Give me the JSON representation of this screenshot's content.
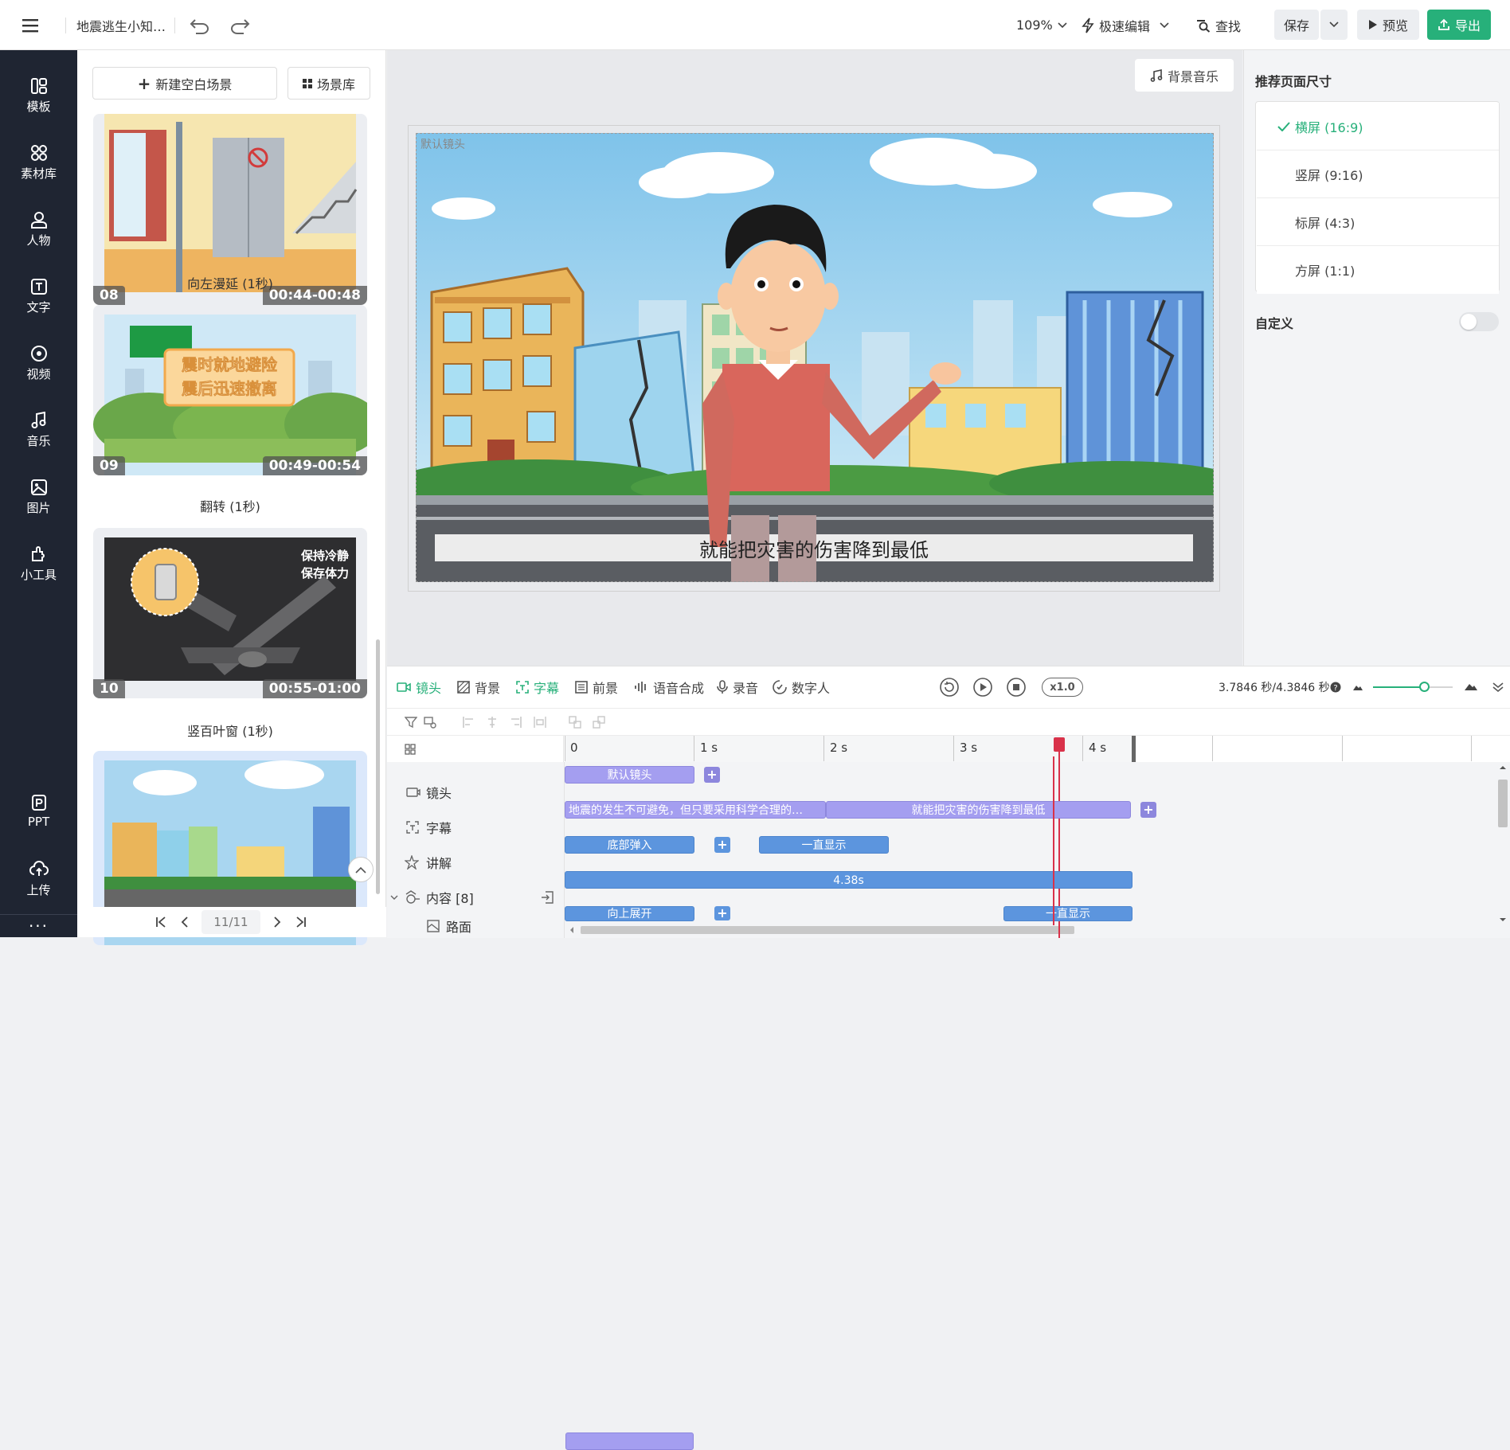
{
  "topbar": {
    "title": "地震逃生小知…",
    "zoom": "109%",
    "mode": "极速编辑",
    "find": "查找",
    "save": "保存",
    "preview": "预览",
    "export": "导出"
  },
  "nav": [
    {
      "label": "模板",
      "icon": "template-icon"
    },
    {
      "label": "素材库",
      "icon": "material-icon"
    },
    {
      "label": "人物",
      "icon": "person-icon"
    },
    {
      "label": "文字",
      "icon": "text-icon"
    },
    {
      "label": "视频",
      "icon": "video-icon"
    },
    {
      "label": "音乐",
      "icon": "music-icon"
    },
    {
      "label": "图片",
      "icon": "image-icon"
    },
    {
      "label": "小工具",
      "icon": "tools-icon"
    }
  ],
  "nav_bottom": [
    {
      "label": "PPT",
      "icon": "ppt-icon"
    },
    {
      "label": "上传",
      "icon": "upload-icon"
    }
  ],
  "scene_panel": {
    "new_scene": "新建空白场景",
    "library": "场景库",
    "scenes": [
      {
        "num": "08",
        "time": "00:44-00:48",
        "label": "向左漫延 (1秒)"
      },
      {
        "num": "09",
        "time": "00:49-00:54",
        "label": "翻转 (1秒)",
        "sign_line1": "震时就地避险",
        "sign_line2": "震后迅速撤离"
      },
      {
        "num": "10",
        "time": "00:55-01:00",
        "label": "竖百叶窗 (1秒)",
        "text_line1": "保持冷静",
        "text_line2": "保存体力"
      }
    ],
    "pager": "11/11"
  },
  "canvas": {
    "bg_music": "背景音乐",
    "default_lens": "默认镜头",
    "subtitle": "就能把灾害的伤害降到最低"
  },
  "right_panel": {
    "title": "推荐页面尺寸",
    "options": [
      {
        "label": "横屏 (16:9)",
        "selected": true
      },
      {
        "label": "竖屏 (9:16)",
        "selected": false
      },
      {
        "label": "标屏 (4:3)",
        "selected": false
      },
      {
        "label": "方屏 (1:1)",
        "selected": false
      }
    ],
    "custom": "自定义"
  },
  "timeline": {
    "tabs": [
      "镜头",
      "背景",
      "字幕",
      "前景",
      "语音合成",
      "录音",
      "数字人"
    ],
    "speed": "x1.0",
    "time_readout": "3.7846 秒/4.3846 秒",
    "ruler": [
      "0",
      "1 s",
      "2 s",
      "3 s",
      "4 s"
    ],
    "tracks": [
      {
        "label": "镜头",
        "icon": "camera-icon"
      },
      {
        "label": "字幕",
        "icon": "subtitle-icon"
      },
      {
        "label": "讲解",
        "icon": "star-icon"
      },
      {
        "label": "内容 [8]",
        "icon": "content-icon"
      },
      {
        "label": "路面",
        "icon": "image-layer-icon"
      }
    ],
    "clips": {
      "lens": "默认镜头",
      "subtitle1": "地震的发生不可避免，但只要采用科学合理的…",
      "subtitle2": "就能把灾害的伤害降到最低",
      "explain1": "底部弹入",
      "explain2": "一直显示",
      "content": "4.38s",
      "road1": "向上展开",
      "road2": "一直显示"
    }
  },
  "colors": {
    "accent": "#27b07a",
    "sidebar": "#1f2532",
    "clip_purple": "#a49ef0",
    "clip_blue": "#5c95de",
    "playhead": "#d9324a"
  }
}
